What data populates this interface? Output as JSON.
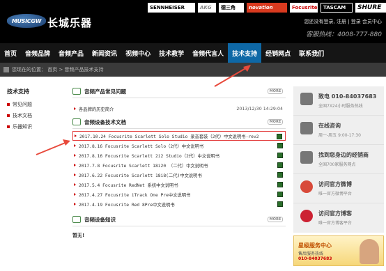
{
  "header": {
    "logo_text": "MUSICGW",
    "site_name": "长城乐器",
    "brands": [
      "SENNHEISER",
      "AKG",
      "德三角",
      "novation",
      "Focusrite",
      "TASCAM",
      "SHURE"
    ],
    "top_links": "您还没有登录, 注册 | 登录 会员中心",
    "hotline": "客服热线：4008-777-880"
  },
  "nav": {
    "items": [
      "首页",
      "音频品牌",
      "音频产品",
      "新闻资讯",
      "视频中心",
      "技术教学",
      "音频代言人",
      "技术支持",
      "经销网点",
      "联系我们"
    ],
    "active_index": 7
  },
  "breadcrumb": "您现在的位置： 首页 > 音频产品技术支持",
  "left_nav": {
    "title": "技术支持",
    "items": [
      "常见问题",
      "技术文档",
      "乐器知识"
    ]
  },
  "faq": {
    "title": "音频产品常见问题",
    "more": "MORE",
    "rows": [
      {
        "text": "各品牌的历史简介",
        "date": "2013/12/30 14:29:04"
      }
    ]
  },
  "docs": {
    "title": "音频设备技术文档",
    "more": "MORE",
    "rows": [
      "2017.10.24 Focusrite Scarlett Solo Studio 录音套装（2代）中文说明书-rev2",
      "2017.8.16 Focusrite Scarlett Solo（2代）中文说明书",
      "2017.8.16 Focusrite Scarlett 2i2 Studio（2代）中文说明书",
      "2017.7.8 Focusrite Scarlett 18i20 （二代）中文说明书",
      "2017.6.22 Focusrite Scarlett 18i8(二代)中文说明书",
      "2017.5.4 Focusrite RedNet 系统中文说明书",
      "2017.4.27 Focusrite iTrack One Pre中文说明书",
      "2017.4.19 Focusrite Red 8Pre中文说明书"
    ],
    "highlight_index": 0
  },
  "knowledge": {
    "title": "音频设备知识",
    "more": "MORE",
    "empty_text": "暂无!"
  },
  "sidebar": {
    "items": [
      {
        "title": "致电  010-84037683",
        "sub": "全国7X24小时服务热线",
        "icon": "phone-icon"
      },
      {
        "title": "在线咨询",
        "sub": "周一-周五 9:00-17:30",
        "icon": "chat-icon"
      },
      {
        "title": "找到您身边的经销商",
        "sub": "全国700家服务网点",
        "icon": "pointer-icon"
      },
      {
        "title": "访问官方微博",
        "sub": "唯一官方微博平台",
        "icon": "weibo-icon"
      },
      {
        "title": "访问官方博客",
        "sub": "唯一官方博客平台",
        "icon": "blog-icon"
      }
    ]
  },
  "promo": {
    "title": "星级服务中心",
    "sub": "售后服务热线",
    "phone": "010-84037683"
  },
  "colors": {
    "nav_active": "#0e68a6",
    "highlight": "#e23a3a",
    "arrow": "#e84a3c"
  }
}
